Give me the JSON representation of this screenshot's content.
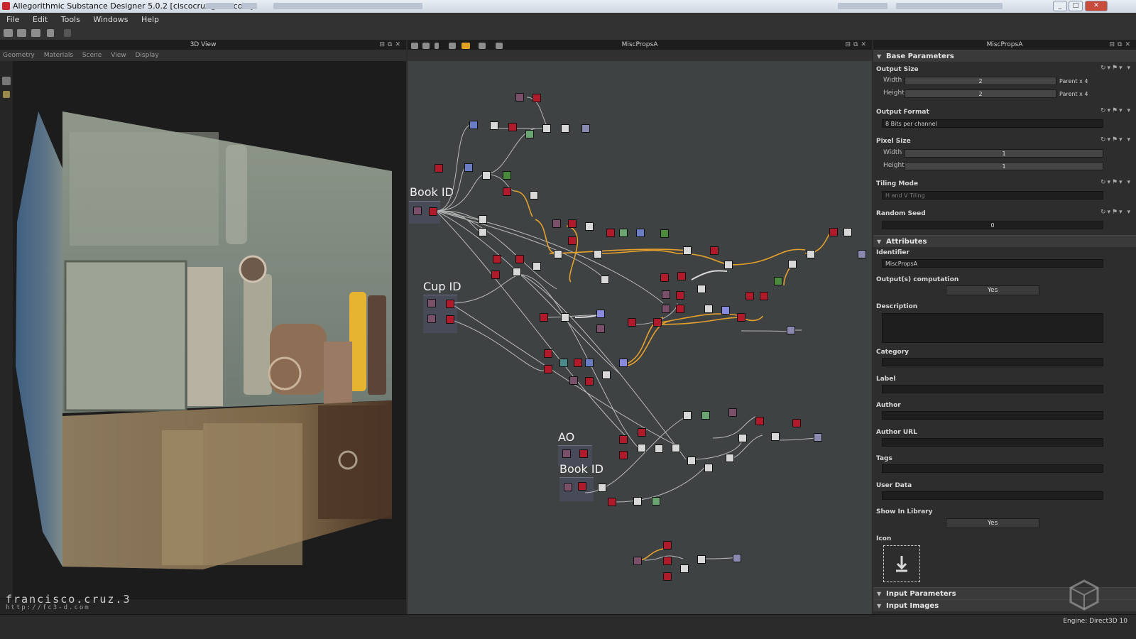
{
  "window": {
    "title": "Allegorithmic Substance Designer 5.0.2 [ciscocruz@live.com]"
  },
  "menu": {
    "items": [
      "File",
      "Edit",
      "Tools",
      "Windows",
      "Help"
    ]
  },
  "view3d": {
    "title": "3D View",
    "submenu": [
      "Geometry",
      "Materials",
      "Scene",
      "View",
      "Display"
    ],
    "watermark": "francisco.cruz.3",
    "watermark_url": "http://fc3-d.com"
  },
  "graph": {
    "title": "MiscPropsA",
    "frames": [
      "Book ID",
      "Cup ID",
      "AO",
      "Book ID"
    ]
  },
  "props": {
    "title": "MiscPropsA",
    "base_parameters": "Base Parameters",
    "output_size": {
      "label": "Output Size",
      "width_label": "Width",
      "width_value": "2",
      "width_mode": "Parent x 4",
      "height_label": "Height",
      "height_value": "2",
      "height_mode": "Parent x 4"
    },
    "output_format": {
      "label": "Output Format",
      "value": "8 Bits per channel"
    },
    "pixel_size": {
      "label": "Pixel Size",
      "width_label": "Width",
      "width_value": "1",
      "height_label": "Height",
      "height_value": "1"
    },
    "tiling_mode": {
      "label": "Tiling Mode",
      "value": "H and V Tiling"
    },
    "random_seed": {
      "label": "Random Seed",
      "value": "0"
    },
    "attributes": "Attributes",
    "identifier": {
      "label": "Identifier",
      "value": "MiscPropsA"
    },
    "outputs_computation": {
      "label": "Output(s) computation",
      "value": "Yes"
    },
    "description": {
      "label": "Description"
    },
    "category": {
      "label": "Category"
    },
    "label_field": {
      "label": "Label"
    },
    "author": {
      "label": "Author"
    },
    "author_url": {
      "label": "Author URL"
    },
    "tags": {
      "label": "Tags"
    },
    "user_data": {
      "label": "User Data"
    },
    "show_in_library": {
      "label": "Show In Library",
      "value": "Yes"
    },
    "icon": {
      "label": "Icon"
    },
    "input_parameters": "Input Parameters",
    "input_images": "Input Images"
  },
  "status": {
    "engine": "Engine: Direct3D 10"
  },
  "colors": {
    "node_red": "#b01a2a",
    "node_white": "#d8d8d8",
    "node_green": "#4a8a3c",
    "node_blue": "#6a7cc4",
    "node_purple": "#7a4f6a",
    "wire_orange": "#e6a02c",
    "wire_gray": "#b8b8b8"
  }
}
